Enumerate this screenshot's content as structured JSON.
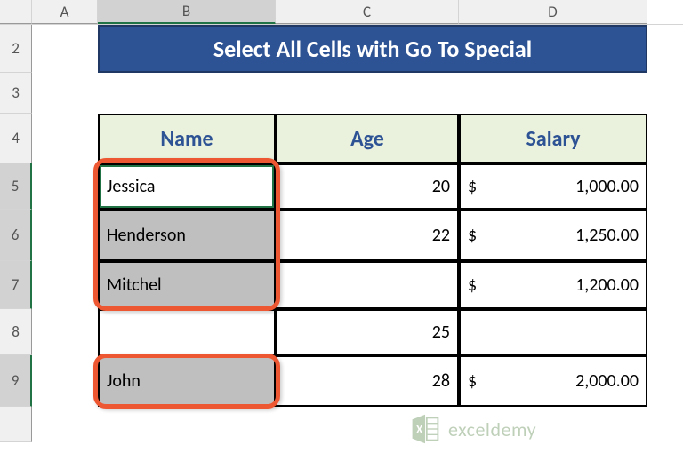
{
  "columns": {
    "A": "A",
    "B": "B",
    "C": "C",
    "D": "D"
  },
  "rows": {
    "2": "2",
    "3": "3",
    "4": "4",
    "5": "5",
    "6": "6",
    "7": "7",
    "8": "8",
    "9": "9"
  },
  "title": "Select All Cells with Go To Special",
  "headers": {
    "name": "Name",
    "age": "Age",
    "salary": "Salary"
  },
  "data": [
    {
      "name": "Jessica",
      "age": "20",
      "cur": "$",
      "salary": "1,000.00"
    },
    {
      "name": "Henderson",
      "age": "22",
      "cur": "$",
      "salary": "1,250.00"
    },
    {
      "name": "Mitchel",
      "age": "",
      "cur": "$",
      "salary": "1,200.00"
    },
    {
      "name": "",
      "age": "25",
      "cur": "",
      "salary": ""
    },
    {
      "name": "John",
      "age": "28",
      "cur": "$",
      "salary": "2,000.00"
    }
  ],
  "watermark": "exceldemy",
  "chart_data": {
    "type": "table",
    "title": "Select All Cells with Go To Special",
    "columns": [
      "Name",
      "Age",
      "Salary"
    ],
    "rows": [
      [
        "Jessica",
        20,
        1000.0
      ],
      [
        "Henderson",
        22,
        1250.0
      ],
      [
        "Mitchel",
        null,
        1200.0
      ],
      [
        null,
        25,
        null
      ],
      [
        "John",
        28,
        2000.0
      ]
    ],
    "selected_cells": [
      "B5",
      "B6",
      "B7",
      "B9"
    ],
    "active_cell": "B5"
  }
}
